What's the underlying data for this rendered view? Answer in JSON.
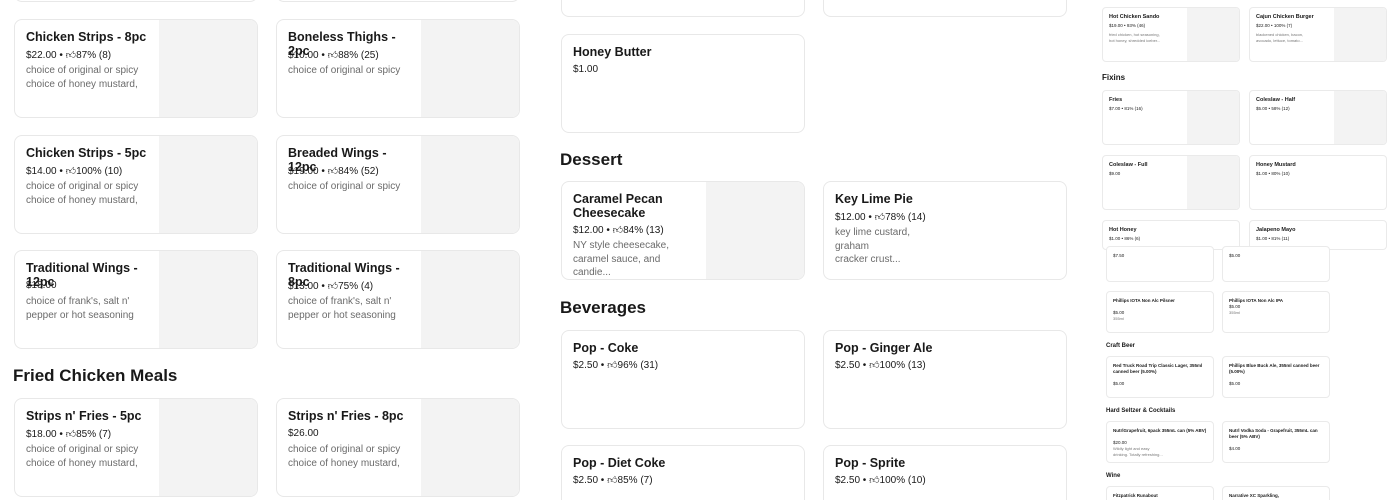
{
  "sections": {
    "fried_chicken_meals": "Fried Chicken Meals",
    "dessert": "Dessert",
    "beverages": "Beverages",
    "fixins": "Fixins",
    "craft_beer": "Craft Beer",
    "hard_seltzer": "Hard Seltzer & Cocktails",
    "wine": "Wine"
  },
  "left_items": [
    {
      "name": "Chicken Strips - 8pc",
      "price": "$22.00",
      "rating": "87% (8)",
      "desc1": "choice of original or spicy",
      "desc2": "choice of honey mustard,"
    },
    {
      "name": "Boneless Thighs - 2pc",
      "price": "$10.00",
      "rating": "88% (25)",
      "desc1": "choice of original or spicy",
      "desc2": ""
    },
    {
      "name": "Chicken Strips - 5pc",
      "price": "$14.00",
      "rating": "100% (10)",
      "desc1": "choice of original or spicy",
      "desc2": "choice of honey mustard,"
    },
    {
      "name": "Breaded Wings - 12pc",
      "price": "$19.00",
      "rating": "84% (52)",
      "desc1": "choice of original or spicy",
      "desc2": ""
    },
    {
      "name": "Traditional Wings - 12pc",
      "price": "$18.00",
      "rating": "",
      "desc1": "choice of frank's, salt n'",
      "desc2": "pepper or hot seasoning"
    },
    {
      "name": "Traditional Wings - 8pc",
      "price": "$13.00",
      "rating": "75% (4)",
      "desc1": "choice of frank's, salt n'",
      "desc2": "pepper or hot seasoning"
    },
    {
      "name": "Strips n' Fries - 5pc",
      "price": "$18.00",
      "rating": "85% (7)",
      "desc1": "choice of original or spicy",
      "desc2": "choice of honey mustard,"
    },
    {
      "name": "Strips n' Fries - 8pc",
      "price": "$26.00",
      "rating": "",
      "desc1": "choice of original or spicy",
      "desc2": "choice of honey mustard,"
    }
  ],
  "mid_items": {
    "honey_butter": {
      "name": "Honey Butter",
      "price": "$1.00"
    },
    "caramel": {
      "name": "Caramel Pecan Cheesecake",
      "price": "$12.00",
      "rating": "84% (13)",
      "desc1": "NY style cheesecake,",
      "desc2": "caramel sauce, and candie..."
    },
    "key_lime": {
      "name": "Key Lime Pie",
      "price": "$12.00",
      "rating": "78% (14)",
      "desc1": "key lime custard, graham",
      "desc2": "cracker crust..."
    },
    "coke": {
      "name": "Pop - Coke",
      "price": "$2.50",
      "rating": "96% (31)"
    },
    "ginger": {
      "name": "Pop - Ginger Ale",
      "price": "$2.50",
      "rating": "100% (13)"
    },
    "diet": {
      "name": "Pop - Diet Coke",
      "price": "$2.50",
      "rating": "85% (7)"
    },
    "sprite": {
      "name": "Pop - Sprite",
      "price": "$2.50",
      "rating": "100% (10)"
    }
  },
  "right_items": {
    "sando": {
      "name": "Hot Chicken Sando",
      "meta": "$19.00 • 93% (46)",
      "d1": "fried chicken, hot seasoning,",
      "d2": "hot honey, shredded iceber..."
    },
    "burger": {
      "name": "Cajun Chicken Burger",
      "meta": "$22.00 • 100% (7)",
      "d1": "blackened chicken, bacon,",
      "d2": "avocado, lettuce, tomato..."
    },
    "fries": {
      "name": "Fries",
      "meta": "$7.00 • 81% (16)"
    },
    "coleslaw_half": {
      "name": "Coleslaw - Half",
      "meta": "$5.00 • 58% (12)"
    },
    "coleslaw_full": {
      "name": "Coleslaw - Full",
      "meta": "$9.00"
    },
    "honey_mustard": {
      "name": "Honey Mustard",
      "meta": "$1.00 • 80% (10)"
    },
    "hot_honey": {
      "name": "Hot Honey",
      "meta": "$1.00 • 86% (6)"
    },
    "jalapeno": {
      "name": "Jalapeno Mayo",
      "meta": "$1.00 • 81% (11)"
    },
    "p750": {
      "meta": "$7.50"
    },
    "p500": {
      "meta": "$5.00"
    },
    "pilsner": {
      "name": "Phillips IOTA Non Alc Pilsner",
      "meta": "$5.00",
      "d1": "355ml"
    },
    "ipa": {
      "name": "Phillips IOTA Non Alc IPA",
      "meta": "$5.00",
      "d1": "355ml"
    },
    "red_truck": {
      "name": "Red Truck Road Trip Classic Lager, 355ml canned beer (5.00%)",
      "meta": "$5.00"
    },
    "blue_buck": {
      "name": "Phillips Blue Buck Ale, 355ml canned beer (5.00%)",
      "meta": "$5.00"
    },
    "nutrl": {
      "name": "NutrlGrapefruit, 6pack 355mL can (5% ABV)",
      "meta": "$20.00",
      "d1": "Wildly light and easy",
      "d2": "drinking. Totally refreshing..."
    },
    "vodka_soda": {
      "name": "Nutrl Vodka Soda - Grapefruit, 355mL can beer (5% ABV)",
      "meta": "$4.00"
    },
    "fitzpatrick": {
      "name": "Fitzpatrick Runabout"
    },
    "narrative": {
      "name": "Narrative XC Sparkling,"
    }
  }
}
